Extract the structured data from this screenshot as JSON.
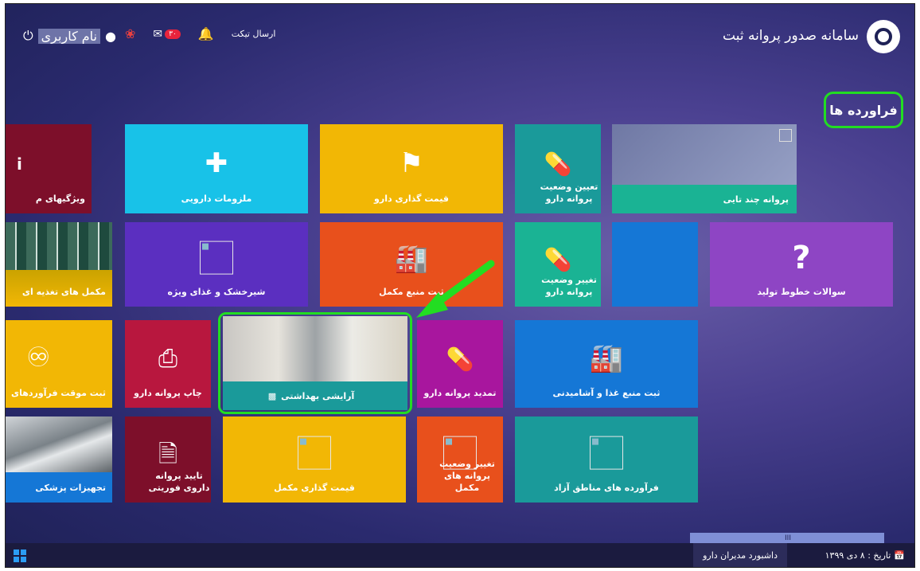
{
  "header": {
    "app_title": "سامانه صدور پروانه ثبت",
    "user_name": "نام کاربری",
    "ticket_label": "ارسال تیکت",
    "mail_badge": "۳۰"
  },
  "section": {
    "title": "فراورده ها"
  },
  "tiles": {
    "features": "ویژگیهای م",
    "supplies": "ملزومات دارویی",
    "drug_pricing": "قیمت گذاری دارو",
    "license_status_determine": "تعیین وضعیت پروانه دارو",
    "multi_license": "پروانه چند تایی",
    "supplements_food": "مکمل های تغذیه ای",
    "infant_formula": "شیرخشک و غذای ویژه",
    "supplement_source": "ثبت منبع مکمل",
    "license_status_change": "تغییر وضعیت پروانه دارو",
    "production_lines_faq": "سوالات خطوط تولید",
    "temp_registration": "ثبت موقت فرآوردهای",
    "print_license": "چاپ پروانه دارو",
    "cosmetics": "آرایشی بهداشتی",
    "license_renewal": "تمدید پروانه دارو",
    "food_source": "ثبت منبع غذا و آشامیدنی",
    "medical_equipment": "تجهیزات پزشکی",
    "urgent_approval": "تایید پروانه داروی فوریتی",
    "supplement_pricing": "قیمت گذاری مکمل",
    "supplement_status_change": "تغییر وضعیت پروانه های مکمل",
    "free_zones": "فرآورده های مناطق آزاد"
  },
  "scrollbar": {
    "thumb_label": "III"
  },
  "taskbar": {
    "dashboard": "داشبورد مدیران دارو",
    "date_label": "تاریخ : ۸ دی ۱۳۹۹"
  },
  "colors": {
    "green_highlight": "#22dd22",
    "teal": "#1a9a9a",
    "maroon": "#7d0f2a"
  }
}
